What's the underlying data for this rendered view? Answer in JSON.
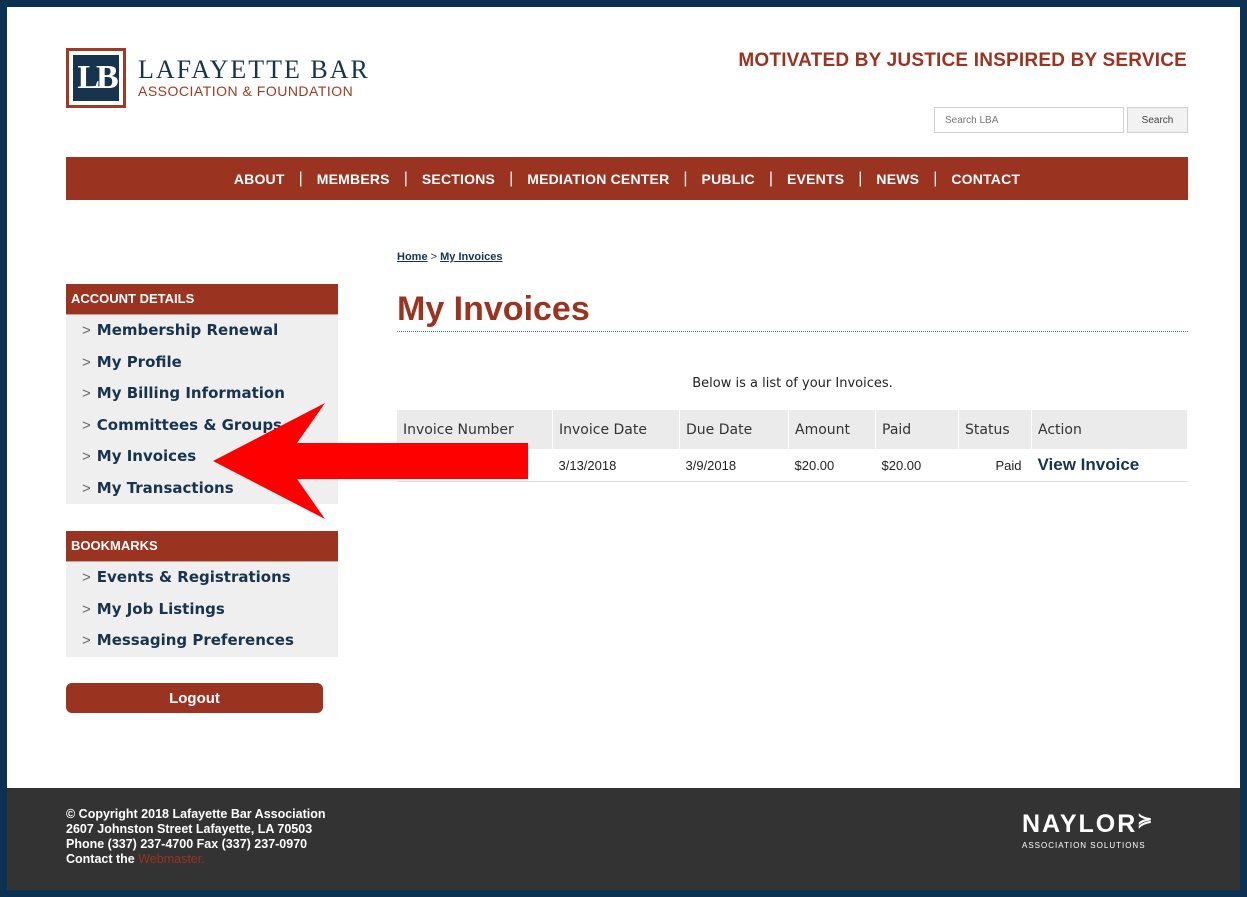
{
  "header": {
    "logo_initials": "LB",
    "logo_name": "LAFAYETTE BAR",
    "logo_sub": "ASSOCIATION & FOUNDATION",
    "tagline": "MOTIVATED BY JUSTICE INSPIRED BY SERVICE",
    "search_placeholder": "Search LBA",
    "search_button": "Search"
  },
  "nav": {
    "items": [
      "ABOUT",
      "MEMBERS",
      "SECTIONS",
      "MEDIATION CENTER",
      "PUBLIC",
      "EVENTS",
      "NEWS",
      "CONTACT"
    ],
    "separator": "|"
  },
  "sidebar": {
    "account": {
      "title": "ACCOUNT DETAILS",
      "items": [
        "Membership Renewal",
        "My Profile",
        "My Billing Information",
        "Committees & Groups",
        "My Invoices",
        "My Transactions"
      ]
    },
    "bookmarks": {
      "title": "BOOKMARKS",
      "items": [
        "Events & Registrations",
        "My Job Listings",
        "Messaging Preferences"
      ]
    },
    "item_prefix": ">",
    "logout": "Logout"
  },
  "breadcrumb": {
    "home": "Home",
    "separator": ">",
    "current": "My Invoices"
  },
  "main": {
    "title": "My Invoices",
    "intro": "Below is a list of your Invoices.",
    "table": {
      "columns": [
        "Invoice Number",
        "Invoice Date",
        "Due Date",
        "Amount",
        "Paid",
        "Status",
        "Action"
      ],
      "rows": [
        {
          "invoice_number": "",
          "invoice_date": "3/13/2018",
          "due_date": "3/9/2018",
          "amount": "$20.00",
          "paid": "$20.00",
          "status": "Paid",
          "action": "View Invoice"
        }
      ]
    }
  },
  "annotation": {
    "arrow_color": "#ff0000"
  },
  "footer": {
    "copyright": "© Copyright 2018 Lafayette Bar Association",
    "address": "2607 Johnston Street Lafayette, LA 70503",
    "phone": "Phone (337) 237-4700 Fax (337) 237-0970",
    "contact_prefix": "Contact the",
    "webmaster": "Webmaster.",
    "brand": "NAYLOR",
    "brand_sub": "ASSOCIATION SOLUTIONS"
  },
  "colors": {
    "brand_red": "#9b3321",
    "navy": "#17344f",
    "footer_bg": "#333333"
  }
}
